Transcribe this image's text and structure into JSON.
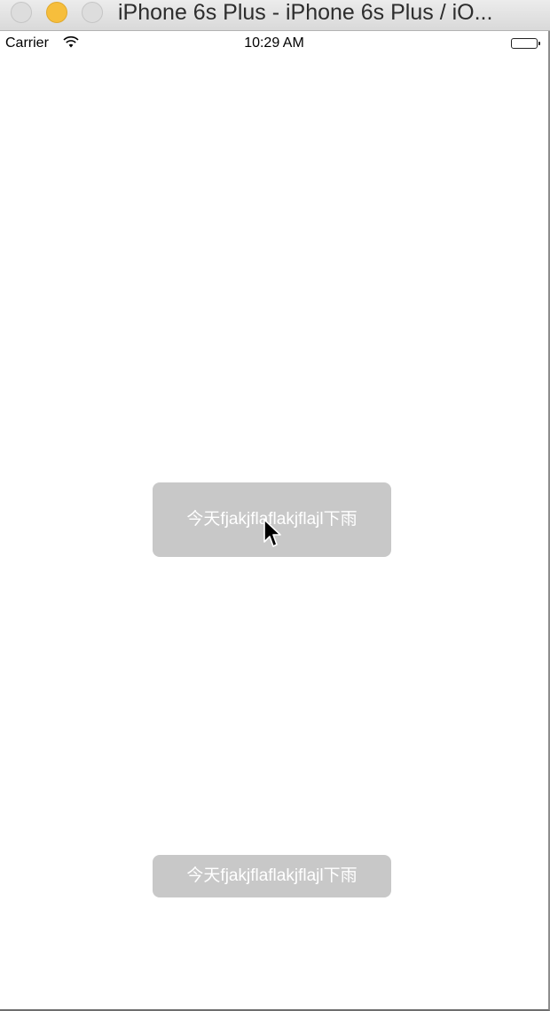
{
  "window": {
    "title": "iPhone 6s Plus - iPhone 6s Plus / iO..."
  },
  "status_bar": {
    "carrier": "Carrier",
    "wifi_icon": "wifi-icon",
    "time": "10:29 AM",
    "battery_icon": "battery-icon"
  },
  "toasts": [
    {
      "text": "今天fjakjflaflakjflajl下雨"
    },
    {
      "text": "今天fjakjflaflakjflajl下雨"
    }
  ],
  "pointer": {
    "icon": "arrow-cursor-icon"
  }
}
